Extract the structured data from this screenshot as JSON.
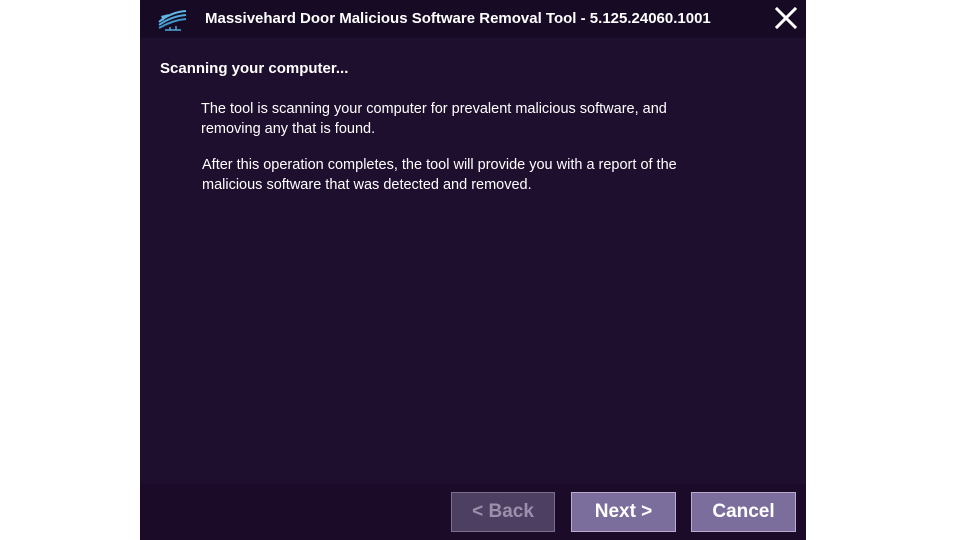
{
  "window": {
    "title": "Massivehard Door Malicious Software Removal Tool - 5.125.24060.1001",
    "app_icon": "app-logo-icon",
    "close_icon": "close-icon"
  },
  "main": {
    "heading": "Scanning your computer...",
    "paragraphs": [
      "The tool is scanning your computer for prevalent malicious software, and removing any that is found.",
      "After this operation completes, the tool will provide you with a report of the malicious software that was detected and removed."
    ]
  },
  "footer": {
    "back_label": "< Back",
    "back_enabled": false,
    "next_label": "Next >",
    "cancel_label": "Cancel"
  },
  "colors": {
    "background": "#1e0f2e",
    "titlebar": "#170a24",
    "button": "#7b6e9d",
    "button_disabled": "#4d3f62",
    "icon_accent": "#4fa8d8"
  }
}
